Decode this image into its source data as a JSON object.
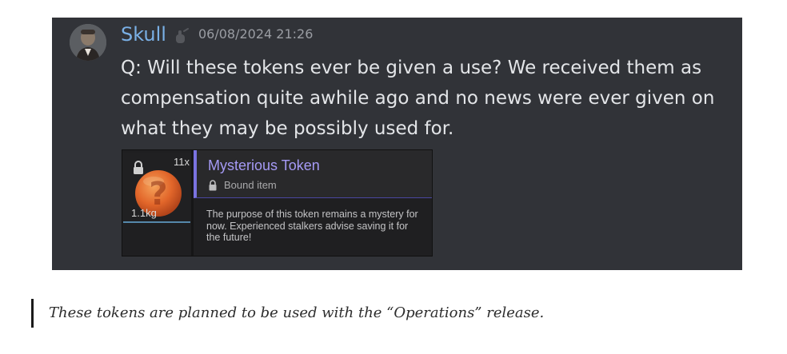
{
  "message": {
    "username": "Skull",
    "timestamp": "06/08/2024 21:26",
    "text": "Q: Will these tokens ever be given a use? We received them as compensation quite awhile ago and no news were ever given on what they may be possibly used for.",
    "username_color": "#7ab0e6",
    "background_color": "#313338"
  },
  "item_card": {
    "quantity": "11x",
    "weight": "1.1kg",
    "name": "Mysterious Token",
    "bound_label": "Bound item",
    "description": "The purpose of this token remains a mystery for now. Experienced stalkers advise saving it for the future!",
    "name_color": "#a59af5",
    "accent_color": "#7a73e0",
    "icon_name": "question-mark-token-icon"
  },
  "reply": {
    "text": "These tokens are planned to be used with the “Operations”  release."
  }
}
